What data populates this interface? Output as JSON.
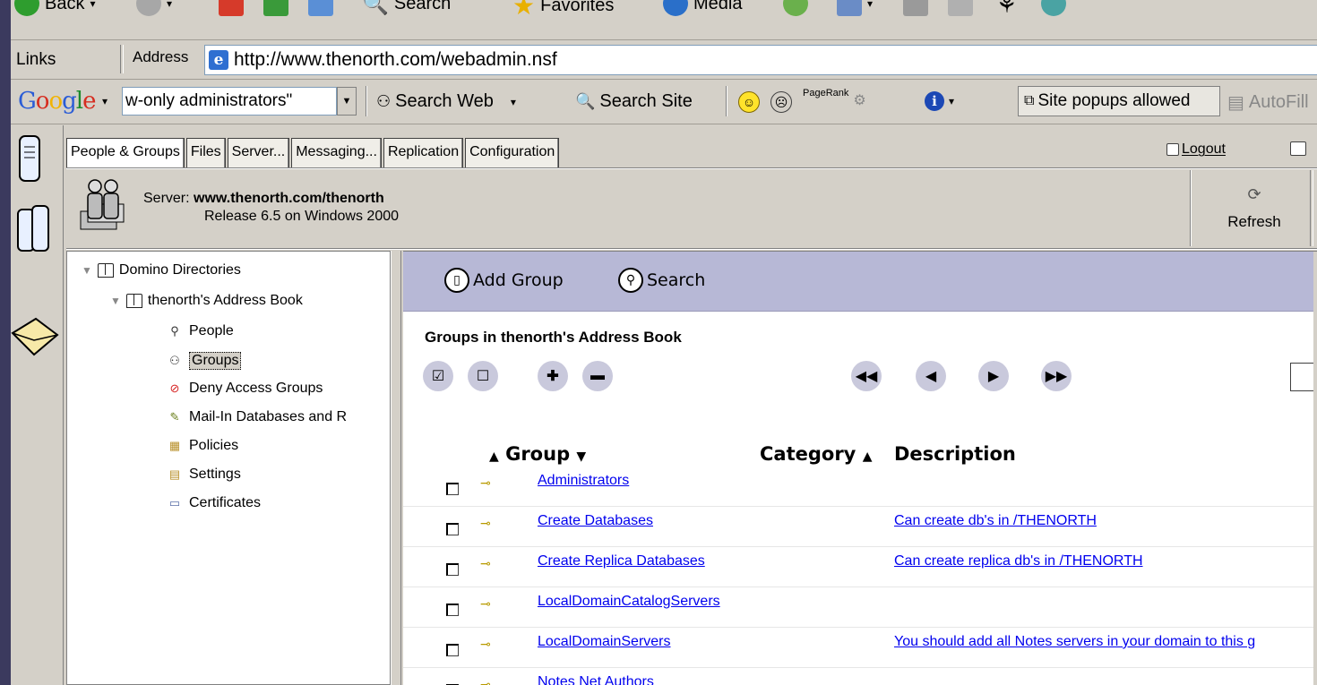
{
  "ie_toolbar": {
    "back": "Back",
    "search": "Search",
    "favorites": "Favorites",
    "media": "Media"
  },
  "address_bar": {
    "links_label": "Links",
    "address_label": "Address",
    "url": "http://www.thenorth.com/webadmin.nsf"
  },
  "google_bar": {
    "logo": "Google",
    "query": "w-only administrators\"",
    "search_web": "Search Web",
    "search_site": "Search Site",
    "pagerank": "PageRank",
    "popups": "Site popups allowed",
    "autofill": "AutoFill"
  },
  "admin": {
    "tabs": [
      "People & Groups",
      "Files",
      "Server...",
      "Messaging...",
      "Replication",
      "Configuration"
    ],
    "active_tab": "People & Groups",
    "logout": "Logout",
    "server_label": "Server:",
    "server_name": "www.thenorth.com/thenorth",
    "release": "Release 6.5 on Windows 2000",
    "refresh": "Refresh"
  },
  "tree": {
    "root": "Domino Directories",
    "book": "thenorth's Address Book",
    "items": [
      {
        "label": "People",
        "icon": "person-icon"
      },
      {
        "label": "Groups",
        "icon": "group-icon",
        "selected": true
      },
      {
        "label": "Deny Access Groups",
        "icon": "deny-icon"
      },
      {
        "label": "Mail-In Databases and R",
        "icon": "mail-in-icon"
      },
      {
        "label": "Policies",
        "icon": "policies-icon"
      },
      {
        "label": "Settings",
        "icon": "settings-icon"
      },
      {
        "label": "Certificates",
        "icon": "certificate-icon"
      }
    ]
  },
  "view": {
    "add_group": "Add Group",
    "search": "Search",
    "title": "Groups in thenorth's Address Book",
    "columns": {
      "group": "Group",
      "category": "Category",
      "description": "Description"
    },
    "rows": [
      {
        "name": "Administrators",
        "description": ""
      },
      {
        "name": "Create Databases",
        "description": "Can create db's in /THENORTH"
      },
      {
        "name": "Create Replica Databases",
        "description": "Can create replica db's in /THENORTH"
      },
      {
        "name": "LocalDomainCatalogServers",
        "description": ""
      },
      {
        "name": "LocalDomainServers",
        "description": "You should add all Notes servers in your domain to this g"
      },
      {
        "name": "Notes Net Authors",
        "description": ""
      }
    ]
  },
  "colors": {
    "window_bg": "#d4d0c8",
    "action_bar": "#b7b8d6",
    "link": "#0000ee",
    "outer_bg": "#3b3a5e"
  }
}
